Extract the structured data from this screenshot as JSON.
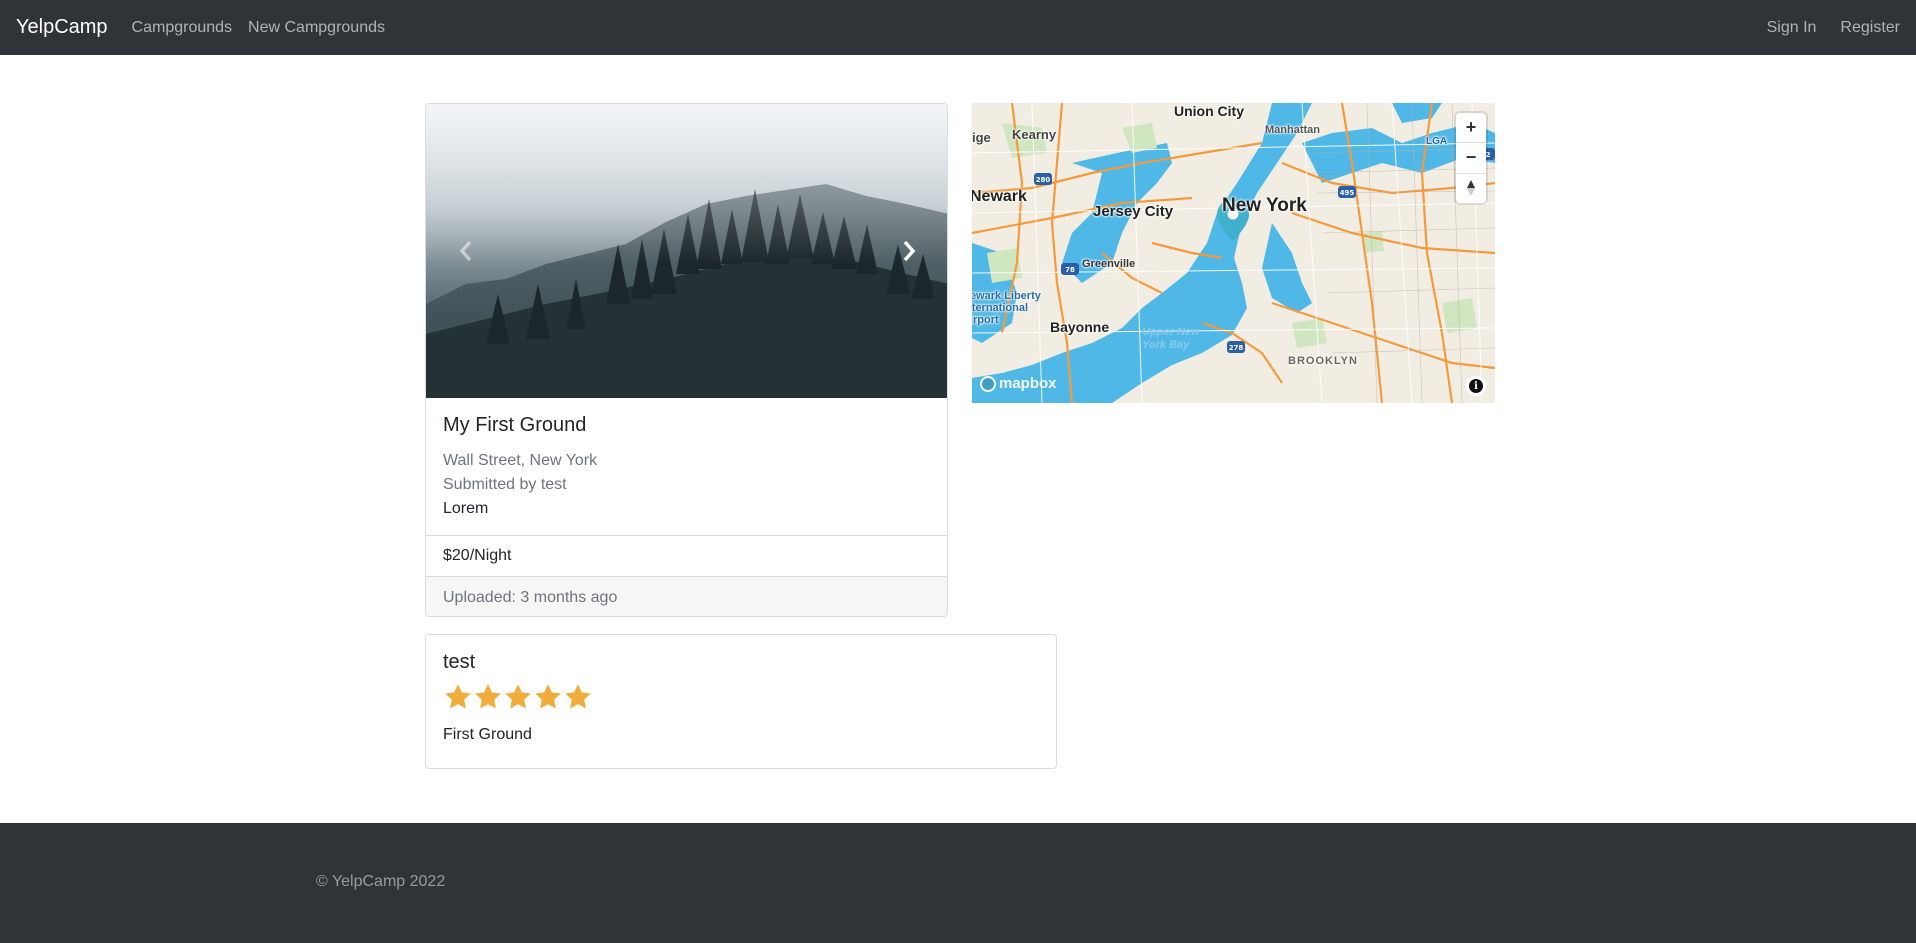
{
  "navbar": {
    "brand": "YelpCamp",
    "links": [
      "Campgrounds",
      "New Campgrounds"
    ],
    "right_links": [
      "Sign In",
      "Register"
    ]
  },
  "campground": {
    "title": "My First Ground",
    "location": "Wall Street, New York",
    "submitted_by": "Submitted by test",
    "description": "Lorem",
    "price": "$20/Night",
    "uploaded": "Uploaded: 3 months ago"
  },
  "carousel": {
    "prev_icon": "chevron-left-icon",
    "next_icon": "chevron-right-icon"
  },
  "map": {
    "labels": {
      "union_city": "Union City",
      "manhattan": "Manhattan",
      "kearny": "Kearny",
      "newark": "Newark",
      "jersey_city": "Jersey City",
      "new_york": "New York",
      "greenville": "Greenville",
      "liberty": "Newark Liberty International Airport",
      "bayonne": "Bayonne",
      "upper_bay": "Upper New York Bay",
      "brooklyn": "BROOKLYN",
      "lga": "LGA",
      "ige": "ige"
    },
    "zoom_in": "+",
    "zoom_out": "−",
    "compass": "compass-icon",
    "logo": "mapbox",
    "info": "i",
    "marker_icon": "map-pin-icon"
  },
  "review": {
    "author": "test",
    "rating": 5,
    "rating_max": 5,
    "text": "First Ground"
  },
  "footer": {
    "copyright": "© YelpCamp 2022"
  },
  "colors": {
    "navbar_bg": "#2f3438",
    "star": "#f0ad3c",
    "water": "#4fb8e6",
    "land": "#f2ede2",
    "marker": "#3fb1ce"
  }
}
